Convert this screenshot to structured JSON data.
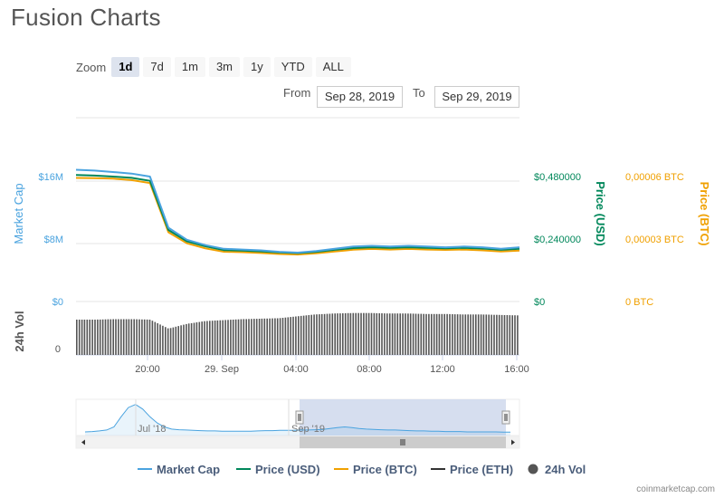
{
  "title": "Fusion Charts",
  "zoom": {
    "label": "Zoom",
    "buttons": [
      "1d",
      "7d",
      "1m",
      "3m",
      "1y",
      "YTD",
      "ALL"
    ],
    "active": "1d"
  },
  "range": {
    "from_label": "From",
    "from_value": "Sep 28, 2019",
    "to_label": "To",
    "to_value": "Sep 29, 2019"
  },
  "colors": {
    "market_cap": "#4aa3df",
    "price_usd": "#00875a",
    "price_btc": "#f0a000",
    "price_eth": "#333333",
    "volume": "#555555",
    "navigator_fill": "#ccd6eb"
  },
  "chart_data": {
    "type": "line",
    "x": [
      "Sep 28 16:00",
      "Sep 28 17:00",
      "Sep 28 18:00",
      "Sep 28 19:00",
      "Sep 28 20:00",
      "Sep 28 21:00",
      "Sep 28 22:00",
      "Sep 28 23:00",
      "Sep 29 00:00",
      "Sep 29 01:00",
      "Sep 29 02:00",
      "Sep 29 03:00",
      "Sep 29 04:00",
      "Sep 29 05:00",
      "Sep 29 06:00",
      "Sep 29 07:00",
      "Sep 29 08:00",
      "Sep 29 09:00",
      "Sep 29 10:00",
      "Sep 29 11:00",
      "Sep 29 12:00",
      "Sep 29 13:00",
      "Sep 29 14:00",
      "Sep 29 15:00",
      "Sep 29 16:00"
    ],
    "series": [
      {
        "name": "Market Cap",
        "axis": "Market Cap",
        "values": [
          17.5,
          17.4,
          17.2,
          17.0,
          16.6,
          9.8,
          8.2,
          7.5,
          7.0,
          6.9,
          6.8,
          6.6,
          6.5,
          6.7,
          7.0,
          7.3,
          7.4,
          7.3,
          7.4,
          7.3,
          7.2,
          7.3,
          7.2,
          7.0,
          7.2
        ]
      },
      {
        "name": "Price (USD)",
        "axis": "Price (USD)",
        "values": [
          0.504,
          0.502,
          0.498,
          0.493,
          0.481,
          0.285,
          0.24,
          0.22,
          0.205,
          0.203,
          0.2,
          0.196,
          0.193,
          0.198,
          0.206,
          0.213,
          0.216,
          0.214,
          0.216,
          0.214,
          0.212,
          0.214,
          0.211,
          0.206,
          0.21
        ]
      },
      {
        "name": "Price (BTC)",
        "axis": "Price (BTC)",
        "values": [
          6.16e-05,
          6.15e-05,
          6.12e-05,
          6.05e-05,
          5.9e-05,
          3.45e-05,
          2.9e-05,
          2.65e-05,
          2.48e-05,
          2.46e-05,
          2.42e-05,
          2.37e-05,
          2.34e-05,
          2.4e-05,
          2.49e-05,
          2.58e-05,
          2.62e-05,
          2.59e-05,
          2.62e-05,
          2.59e-05,
          2.57e-05,
          2.59e-05,
          2.55e-05,
          2.49e-05,
          2.54e-05
        ]
      },
      {
        "name": "24h Vol",
        "axis": "24h Vol",
        "values": [
          0.75,
          0.75,
          0.76,
          0.76,
          0.75,
          0.56,
          0.66,
          0.72,
          0.74,
          0.76,
          0.77,
          0.78,
          0.82,
          0.86,
          0.88,
          0.89,
          0.89,
          0.88,
          0.88,
          0.87,
          0.87,
          0.86,
          0.86,
          0.85,
          0.84
        ]
      }
    ],
    "axes": {
      "market_cap": {
        "label": "Market Cap",
        "ticks": [
          "$16M",
          "$8M",
          "$0"
        ]
      },
      "price_usd": {
        "label": "Price (USD)",
        "ticks": [
          "$0,480000",
          "$0,240000",
          "$0"
        ]
      },
      "price_btc": {
        "label": "Price (BTC)",
        "ticks": [
          "0,00006 BTC",
          "0,00003 BTC",
          "0 BTC"
        ]
      },
      "volume": {
        "label": "24h Vol",
        "ticks": [
          "0"
        ]
      }
    },
    "x_ticks": [
      "20:00",
      "29. Sep",
      "04:00",
      "08:00",
      "12:00",
      "16:00"
    ],
    "navigator": {
      "labels": [
        "Jul '18",
        "Sep '19"
      ],
      "history": [
        0.06,
        0.07,
        0.09,
        0.12,
        0.22,
        0.55,
        0.85,
        0.95,
        0.8,
        0.55,
        0.35,
        0.22,
        0.15,
        0.13,
        0.12,
        0.11,
        0.1,
        0.09,
        0.09,
        0.08,
        0.08,
        0.08,
        0.08,
        0.08,
        0.09,
        0.1,
        0.1,
        0.11,
        0.11,
        0.11,
        0.12,
        0.12,
        0.13,
        0.14,
        0.17,
        0.2,
        0.22,
        0.2,
        0.17,
        0.15,
        0.14,
        0.13,
        0.12,
        0.12,
        0.11,
        0.1,
        0.09,
        0.09,
        0.08,
        0.08,
        0.07,
        0.07,
        0.07,
        0.06,
        0.06,
        0.06,
        0.06,
        0.06,
        0.05,
        0.05
      ]
    },
    "legend": [
      "Market Cap",
      "Price (USD)",
      "Price (BTC)",
      "Price (ETH)",
      "24h Vol"
    ],
    "legend_position": "bottom",
    "grid": true
  },
  "watermark": "coinmarketcap.com"
}
